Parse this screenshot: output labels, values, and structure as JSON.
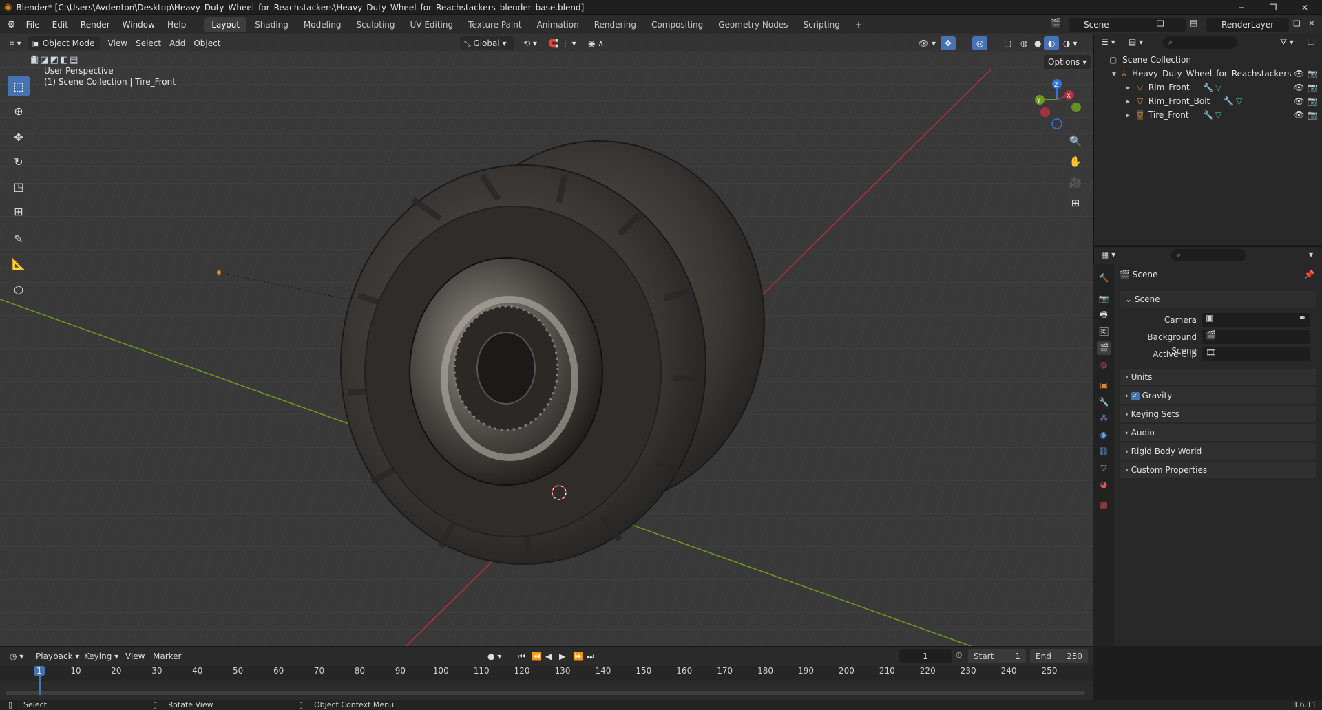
{
  "title": "Blender* [C:\\Users\\Avdenton\\Desktop\\Heavy_Duty_Wheel_for_Reachstackers\\Heavy_Duty_Wheel_for_Reachstackers_blender_base.blend]",
  "menus": [
    "File",
    "Edit",
    "Render",
    "Window",
    "Help"
  ],
  "workspaces": [
    "Layout",
    "Shading",
    "Modeling",
    "Sculpting",
    "UV Editing",
    "Texture Paint",
    "Animation",
    "Rendering",
    "Compositing",
    "Geometry Nodes",
    "Scripting"
  ],
  "scene_field": "Scene",
  "renderlayer_field": "RenderLayer",
  "viewport": {
    "mode": "Object Mode",
    "menus": [
      "View",
      "Select",
      "Add",
      "Object"
    ],
    "transform": "Global",
    "options": "Options",
    "info_line1": "User Perspective",
    "info_line2": "(1) Scene Collection | Tire_Front"
  },
  "outliner": {
    "root": "Scene Collection",
    "collection": "Heavy_Duty_Wheel_for_Reachstackers",
    "items": [
      "Rim_Front",
      "Rim_Front_Bolt",
      "Tire_Front"
    ]
  },
  "properties": {
    "header": "Scene",
    "section": "Scene",
    "camera_label": "Camera",
    "bgscene_label": "Background Scene",
    "clip_label": "Active Clip",
    "panels": [
      "Units",
      "Gravity",
      "Keying Sets",
      "Audio",
      "Rigid Body World",
      "Custom Properties"
    ]
  },
  "timeline": {
    "menus": [
      "Playback",
      "Keying",
      "View",
      "Marker"
    ],
    "current_frame": "1",
    "start_label": "Start",
    "start": "1",
    "end_label": "End",
    "end": "250",
    "ticks": [
      "1",
      "10",
      "20",
      "30",
      "40",
      "50",
      "60",
      "70",
      "80",
      "90",
      "100",
      "110",
      "120",
      "130",
      "140",
      "150",
      "160",
      "170",
      "180",
      "190",
      "200",
      "210",
      "220",
      "230",
      "240",
      "250"
    ]
  },
  "status": {
    "select": "Select",
    "rotate": "Rotate View",
    "context": "Object Context Menu",
    "version": "3.6.11"
  },
  "colors": {
    "accent": "#4772b3",
    "x_axis": "#b3303f",
    "y_axis": "#6d9b20",
    "z_axis": "#2f78d7",
    "object_orange": "#e08a2c"
  }
}
